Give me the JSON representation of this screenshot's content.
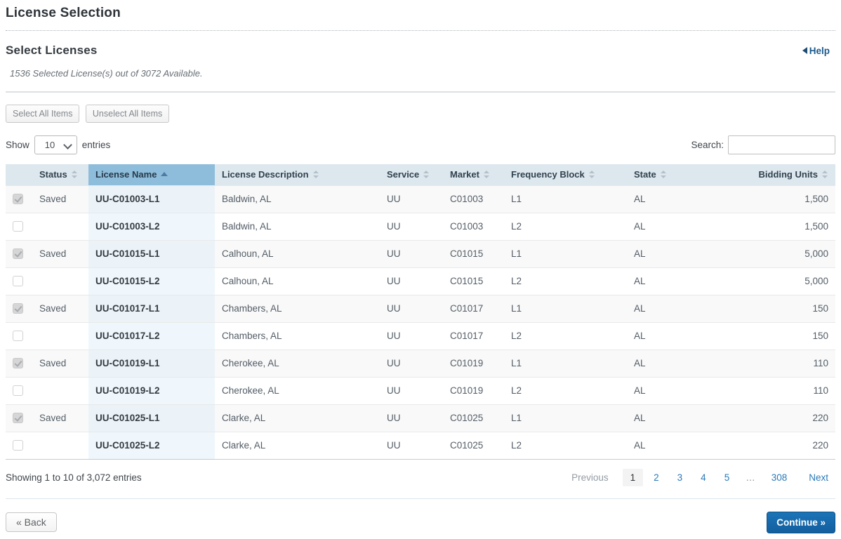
{
  "page": {
    "title": "License Selection",
    "section_title": "Select Licenses",
    "help_label": "Help",
    "notice": "1536 Selected License(s) out of 3072 Available.",
    "select_all_label": "Select All Items",
    "unselect_all_label": "Unselect All Items"
  },
  "length_control": {
    "show_label": "Show",
    "selected": "10",
    "entries_label": "entries"
  },
  "search": {
    "label": "Search:",
    "value": ""
  },
  "table": {
    "headers": [
      {
        "label": "Status",
        "sort": "both"
      },
      {
        "label": "License Name",
        "sort": "asc"
      },
      {
        "label": "License Description",
        "sort": "both"
      },
      {
        "label": "Service",
        "sort": "both"
      },
      {
        "label": "Market",
        "sort": "both"
      },
      {
        "label": "Frequency Block",
        "sort": "both"
      },
      {
        "label": "State",
        "sort": "both"
      },
      {
        "label": "Bidding Units",
        "sort": "both"
      }
    ],
    "rows": [
      {
        "checked": true,
        "status": "Saved",
        "license_name": "UU-C01003-L1",
        "description": "Baldwin, AL",
        "service": "UU",
        "market": "C01003",
        "block": "L1",
        "state": "AL",
        "units": "1,500"
      },
      {
        "checked": false,
        "status": "",
        "license_name": "UU-C01003-L2",
        "description": "Baldwin, AL",
        "service": "UU",
        "market": "C01003",
        "block": "L2",
        "state": "AL",
        "units": "1,500"
      },
      {
        "checked": true,
        "status": "Saved",
        "license_name": "UU-C01015-L1",
        "description": "Calhoun, AL",
        "service": "UU",
        "market": "C01015",
        "block": "L1",
        "state": "AL",
        "units": "5,000"
      },
      {
        "checked": false,
        "status": "",
        "license_name": "UU-C01015-L2",
        "description": "Calhoun, AL",
        "service": "UU",
        "market": "C01015",
        "block": "L2",
        "state": "AL",
        "units": "5,000"
      },
      {
        "checked": true,
        "status": "Saved",
        "license_name": "UU-C01017-L1",
        "description": "Chambers, AL",
        "service": "UU",
        "market": "C01017",
        "block": "L1",
        "state": "AL",
        "units": "150"
      },
      {
        "checked": false,
        "status": "",
        "license_name": "UU-C01017-L2",
        "description": "Chambers, AL",
        "service": "UU",
        "market": "C01017",
        "block": "L2",
        "state": "AL",
        "units": "150"
      },
      {
        "checked": true,
        "status": "Saved",
        "license_name": "UU-C01019-L1",
        "description": "Cherokee, AL",
        "service": "UU",
        "market": "C01019",
        "block": "L1",
        "state": "AL",
        "units": "110"
      },
      {
        "checked": false,
        "status": "",
        "license_name": "UU-C01019-L2",
        "description": "Cherokee, AL",
        "service": "UU",
        "market": "C01019",
        "block": "L2",
        "state": "AL",
        "units": "110"
      },
      {
        "checked": true,
        "status": "Saved",
        "license_name": "UU-C01025-L1",
        "description": "Clarke, AL",
        "service": "UU",
        "market": "C01025",
        "block": "L1",
        "state": "AL",
        "units": "220"
      },
      {
        "checked": false,
        "status": "",
        "license_name": "UU-C01025-L2",
        "description": "Clarke, AL",
        "service": "UU",
        "market": "C01025",
        "block": "L2",
        "state": "AL",
        "units": "220"
      }
    ]
  },
  "footer": {
    "info": "Showing 1 to 10 of 3,072 entries",
    "pagination": {
      "previous": "Previous",
      "pages": [
        "1",
        "2",
        "3",
        "4",
        "5",
        "…",
        "308"
      ],
      "current": "1",
      "next": "Next"
    }
  },
  "actions": {
    "back_label": "« Back",
    "continue_label": "Continue »"
  },
  "colors": {
    "link_blue": "#2a7ab9",
    "header_bg": "#dde7ee",
    "sorted_header_bg": "#8ebddb",
    "continue_bg": "#1568a9",
    "help_blue": "#1b5a8c"
  }
}
